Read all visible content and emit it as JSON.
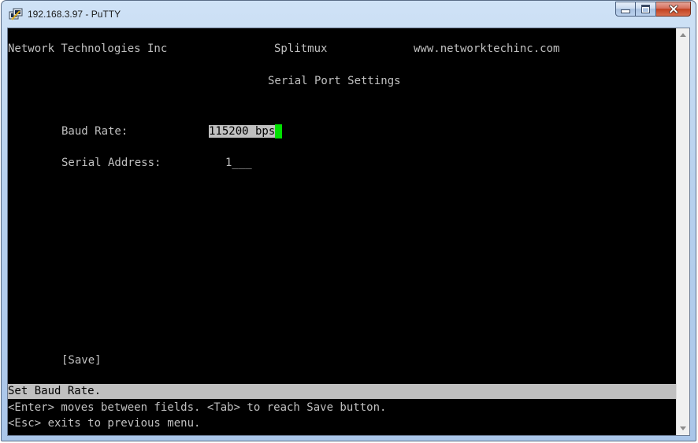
{
  "window": {
    "title": "192.168.3.97 - PuTTY"
  },
  "terminal": {
    "header": {
      "company": "Network Technologies Inc",
      "product": "Splitmux",
      "website": "www.networktechinc.com"
    },
    "screen_title": "Serial Port Settings",
    "fields": {
      "baud_rate_label": "Baud Rate:",
      "baud_rate_value": "115200 bps",
      "serial_address_label": "Serial Address:",
      "serial_address_value": "1___"
    },
    "save_button": "[Save]",
    "status_line": "Set Baud Rate.",
    "help_line_1": "<Enter> moves between fields. <Tab> to reach Save button.",
    "help_line_2": "<Esc> exits to previous menu."
  },
  "colors": {
    "terminal_bg": "#000000",
    "terminal_fg": "#c0c0c0",
    "highlight_bg": "#c0c0c0",
    "cursor": "#00e000"
  }
}
